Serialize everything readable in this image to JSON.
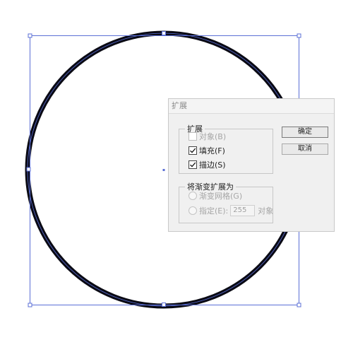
{
  "dialog": {
    "title": "扩展",
    "expand_group": {
      "legend": "扩展",
      "object": {
        "label": "对象(B)",
        "checked": false,
        "disabled": true
      },
      "fill": {
        "label": "填充(F)",
        "checked": true
      },
      "stroke": {
        "label": "描边(S)",
        "checked": true
      }
    },
    "gradient_group": {
      "legend": "将渐变扩展为",
      "mesh": {
        "label": "渐变网格(G)",
        "disabled": true
      },
      "specify": {
        "label": "指定(E):",
        "value": "255",
        "unit": "对象",
        "disabled": true
      }
    },
    "ok_label": "确定",
    "cancel_label": "取消"
  },
  "colors": {
    "ring": "#0a0a14",
    "selection": "#5b6fd6",
    "dialog_bg": "#f0f0f0"
  }
}
